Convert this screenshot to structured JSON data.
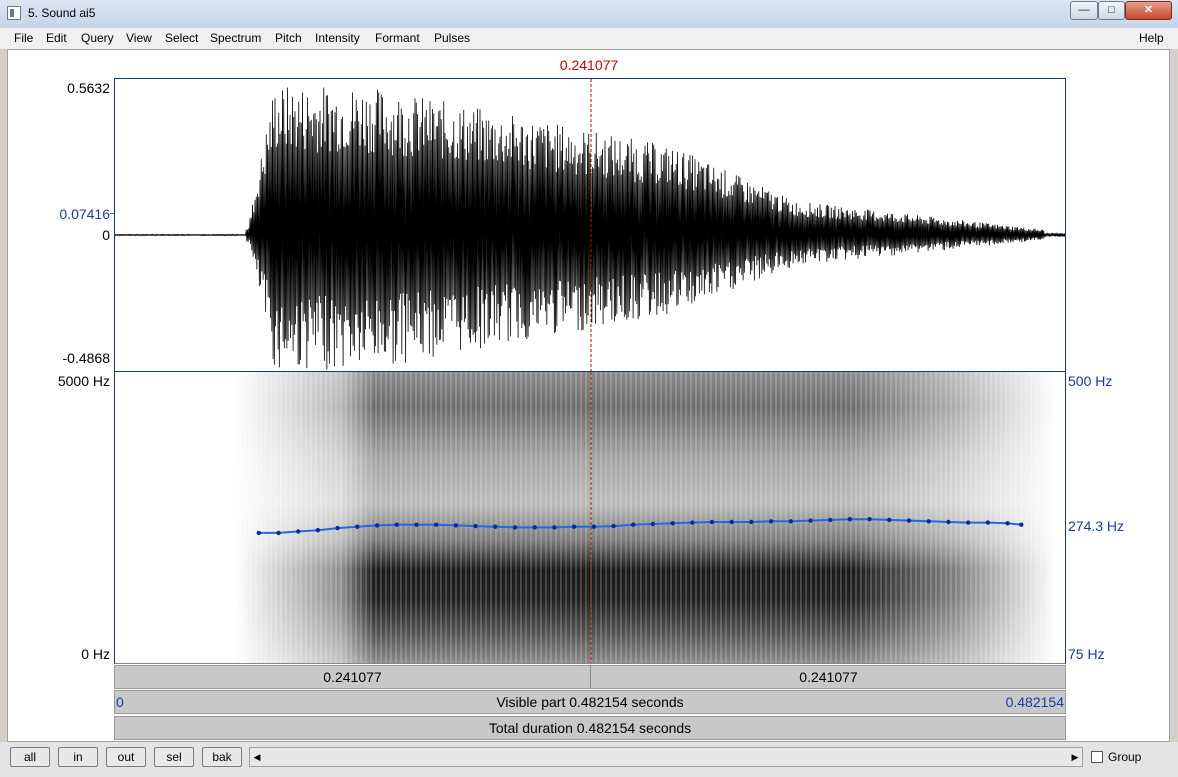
{
  "window": {
    "title": "5. Sound ai5",
    "controls": {
      "minimize": "—",
      "maximize": "□",
      "close": "✕"
    }
  },
  "menu": {
    "items": [
      "File",
      "Edit",
      "Query",
      "View",
      "Select",
      "Spectrum",
      "Pitch",
      "Intensity",
      "Formant",
      "Pulses"
    ],
    "help": "Help"
  },
  "cursor": {
    "time_label": "0.241077",
    "time_seconds": 0.241077
  },
  "waveform": {
    "y_max_label": "0.5632",
    "y_cursor_label": "0.07416",
    "y_zero_label": "0",
    "y_min_label": "-0.4868"
  },
  "spectrogram": {
    "freq_top_label": "5000 Hz",
    "freq_bottom_label": "0 Hz",
    "pitch_top_label": "500 Hz",
    "pitch_cursor_label": "274.3 Hz",
    "pitch_bottom_label": "75 Hz",
    "pitch_range_hz": [
      75,
      500
    ],
    "pitch_contour": {
      "t": [
        0.073,
        0.083,
        0.093,
        0.103,
        0.113,
        0.123,
        0.133,
        0.143,
        0.153,
        0.163,
        0.173,
        0.183,
        0.193,
        0.203,
        0.213,
        0.223,
        0.233,
        0.243,
        0.253,
        0.263,
        0.273,
        0.283,
        0.293,
        0.303,
        0.313,
        0.323,
        0.333,
        0.343,
        0.353,
        0.363,
        0.373,
        0.383,
        0.393,
        0.403,
        0.413,
        0.423,
        0.433,
        0.443,
        0.453,
        0.46
      ],
      "hz": [
        265,
        265,
        267,
        269,
        272,
        274,
        276,
        277,
        277,
        277,
        276,
        275,
        274,
        273,
        273,
        273,
        274,
        274,
        275,
        277,
        278,
        279,
        280,
        281,
        281,
        281,
        282,
        282,
        283,
        284,
        285,
        285,
        284,
        283,
        282,
        281,
        280,
        280,
        279,
        277
      ]
    }
  },
  "timebar": {
    "left_label": "0.241077",
    "right_label": "0.241077",
    "visible_part": "Visible part 0.482154 seconds",
    "visible_start": "0",
    "visible_end": "0.482154",
    "total_duration": "Total duration 0.482154 seconds",
    "duration_seconds": 0.482154
  },
  "bottombar": {
    "buttons": [
      "all",
      "in",
      "out",
      "sel",
      "bak"
    ],
    "scroll_left": "◀",
    "scroll_right": "▶",
    "group_label": "Group",
    "group_checked": false
  }
}
